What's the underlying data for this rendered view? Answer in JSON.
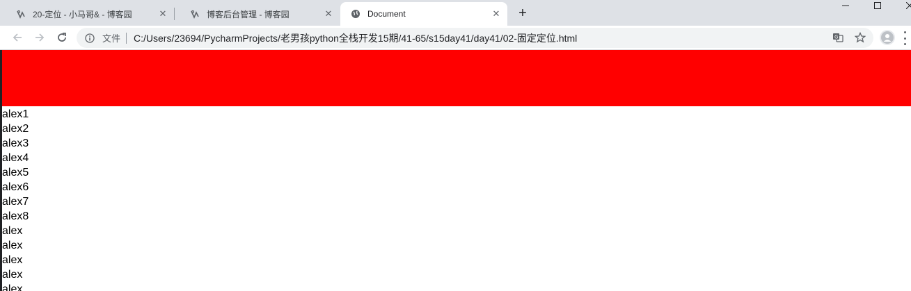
{
  "browser": {
    "tabs": [
      {
        "title": "20-定位 - 小马哥& - 博客园",
        "icon": "blog-favicon-icon",
        "active": false
      },
      {
        "title": "博客后台管理 - 博客园",
        "icon": "blog-favicon-icon",
        "active": false
      },
      {
        "title": "Document",
        "icon": "globe-icon",
        "active": true
      }
    ],
    "new_tab_label": "+",
    "omnibox": {
      "security_label": "文件",
      "url": "C:/Users/23694/PycharmProjects/老男孩python全栈开发15期/41-65/s15day41/day41/02-固定定位.html"
    }
  },
  "page": {
    "fixed_bar_color": "#ff0000",
    "items": [
      "alex1",
      "alex2",
      "alex3",
      "alex4",
      "alex5",
      "alex6",
      "alex7",
      "alex8",
      "alex",
      "alex",
      "alex",
      "alex",
      "alex"
    ]
  }
}
